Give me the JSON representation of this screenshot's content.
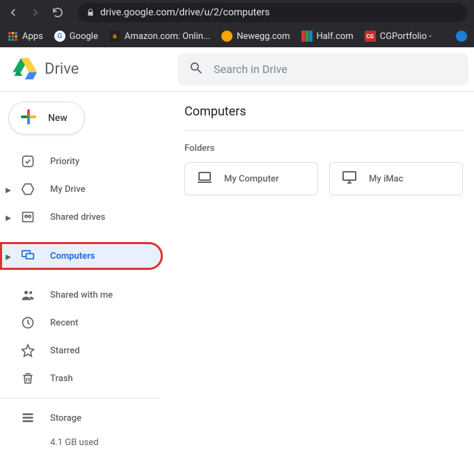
{
  "browser": {
    "url": "drive.google.com/drive/u/2/computers",
    "bookmarks": [
      {
        "label": "Apps",
        "icon": "apps"
      },
      {
        "label": "Google",
        "icon": "google"
      },
      {
        "label": "Amazon.com: Onlin...",
        "icon": "amazon"
      },
      {
        "label": "Newegg.com",
        "icon": "newegg"
      },
      {
        "label": "Half.com",
        "icon": "half"
      },
      {
        "label": "CGPortfolio -",
        "icon": "cg"
      }
    ]
  },
  "header": {
    "product": "Drive",
    "search_placeholder": "Search in Drive"
  },
  "sidebar": {
    "new_label": "New",
    "items": [
      {
        "label": "Priority",
        "icon": "priority",
        "expandable": false
      },
      {
        "label": "My Drive",
        "icon": "mydrive",
        "expandable": true
      },
      {
        "label": "Shared drives",
        "icon": "shareddrives",
        "expandable": true
      },
      {
        "label": "Computers",
        "icon": "computers",
        "expandable": true,
        "active": true,
        "highlighted": true
      },
      {
        "label": "Shared with me",
        "icon": "shared",
        "expandable": false
      },
      {
        "label": "Recent",
        "icon": "recent",
        "expandable": false
      },
      {
        "label": "Starred",
        "icon": "starred",
        "expandable": false
      },
      {
        "label": "Trash",
        "icon": "trash",
        "expandable": false
      }
    ],
    "storage_label": "Storage",
    "storage_used": "4.1 GB used"
  },
  "main": {
    "title": "Computers",
    "section_label": "Folders",
    "folders": [
      {
        "label": "My Computer",
        "icon": "laptop"
      },
      {
        "label": "My iMac",
        "icon": "desktop"
      }
    ]
  }
}
